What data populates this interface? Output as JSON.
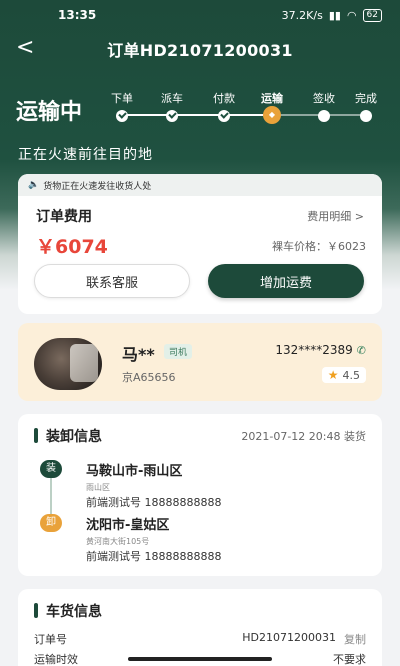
{
  "status_bar": {
    "time": "13:35",
    "network_speed": "37.2K/s",
    "battery": "62"
  },
  "nav": {
    "title": "订单HD21071200031",
    "back_icon": "chevron-left-icon"
  },
  "stage": {
    "current_label": "运输中",
    "steps": [
      "下单",
      "派车",
      "付款",
      "运输",
      "签收",
      "完成"
    ],
    "current_index": 3,
    "current_icon_text": "运输",
    "subtitle": "正在火速前往目的地"
  },
  "fee": {
    "notice": "货物正在火速发往收货人处",
    "title": "订单费用",
    "detail_link": "费用明细 >",
    "amount": "￥6074",
    "bare_price": "裸车价格：￥6023",
    "service_button": "联系客服",
    "add_freight_button": "增加运费"
  },
  "driver": {
    "name": "马**",
    "tag": "司机",
    "phone": "132****2389",
    "plate": "京A65656",
    "rating": "4.5"
  },
  "loading": {
    "title": "装卸信息",
    "time": "2021-07-12 20:48 装货",
    "load_badge": "装",
    "unload_badge": "卸",
    "load": {
      "city": "马鞍山市-雨山区",
      "detail": "雨山区",
      "contact": "前端测试号 18888888888"
    },
    "unload": {
      "city": "沈阳市-皇姑区",
      "detail": "黄河南大街105号",
      "contact": "前端测试号 18888888888"
    }
  },
  "cargo": {
    "title": "车货信息",
    "order_no_label": "订单号",
    "order_no": "HD21071200031",
    "copy_label": "复制",
    "row2_label": "运输时效",
    "row2_value": "不要求"
  },
  "colors": {
    "primary": "#1d4a3a",
    "accent": "#e9a23a",
    "price": "#e8463a",
    "driver_bg": "#fcefd9"
  }
}
